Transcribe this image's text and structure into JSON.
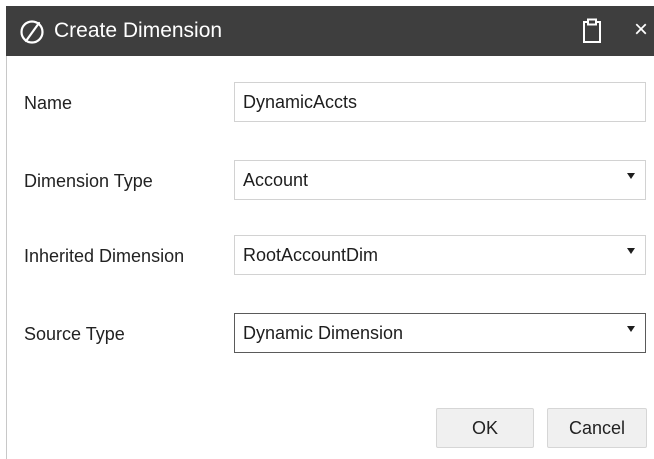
{
  "dialog": {
    "title": "Create Dimension",
    "icons": {
      "logo": "oracle-logo-icon",
      "clipboard": "clipboard-icon",
      "close": "close-icon"
    },
    "close_glyph": "×"
  },
  "form": {
    "name": {
      "label": "Name",
      "value": "DynamicAccts"
    },
    "dimension_type": {
      "label": "Dimension Type",
      "value": "Account"
    },
    "inherited_dimension": {
      "label": "Inherited Dimension",
      "value": "RootAccountDim"
    },
    "source_type": {
      "label": "Source Type",
      "value": "Dynamic Dimension"
    }
  },
  "buttons": {
    "ok": "OK",
    "cancel": "Cancel"
  },
  "colors": {
    "titlebar": "#3e3e3e",
    "button_bg": "#f0f0f0",
    "field_border": "#d2d2d2"
  }
}
